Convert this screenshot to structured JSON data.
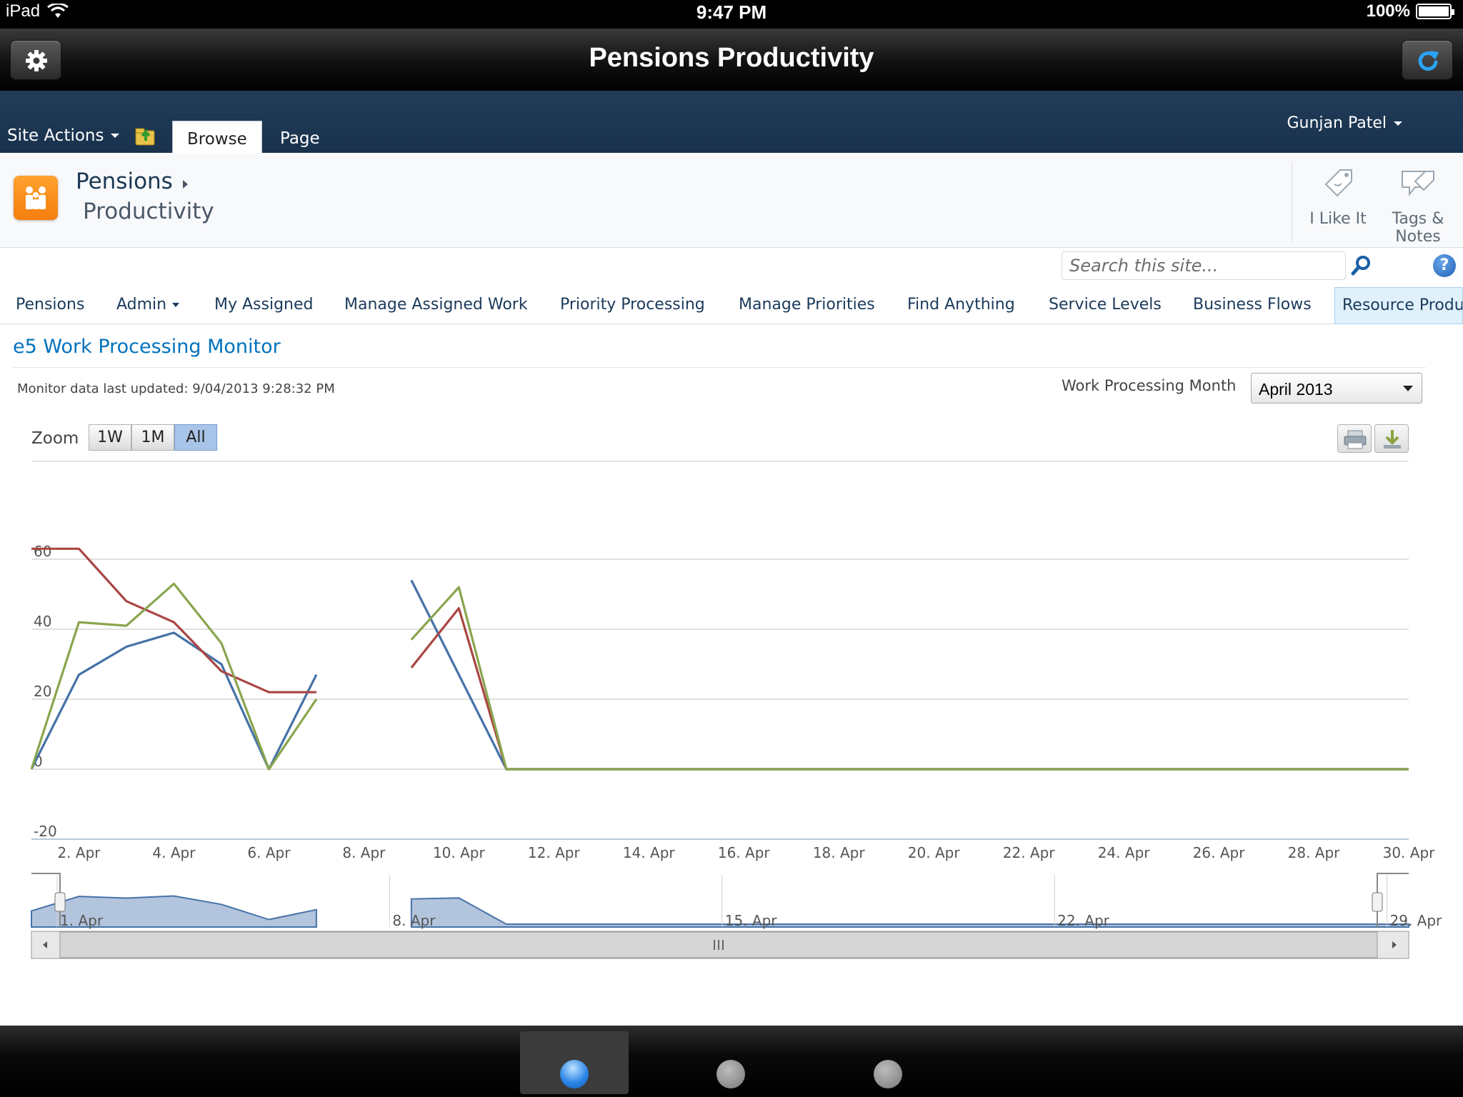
{
  "status_bar": {
    "device": "iPad",
    "time": "9:47 PM",
    "battery": "100%"
  },
  "app": {
    "title": "Pensions Productivity"
  },
  "ribbon": {
    "site_actions": "Site Actions",
    "tabs": [
      "Browse",
      "Page"
    ],
    "user": "Gunjan Patel"
  },
  "title_area": {
    "breadcrumb_root": "Pensions",
    "page_title": "Productivity",
    "like_label": "I Like It",
    "tags_label": "Tags & Notes"
  },
  "search": {
    "placeholder": "Search this site..."
  },
  "nav": {
    "items": [
      "Pensions",
      "Admin",
      "My Assigned",
      "Manage Assigned Work",
      "Priority Processing",
      "Manage Priorities",
      "Find Anything",
      "Service Levels",
      "Business Flows",
      "Resource Productivity"
    ]
  },
  "webpart": {
    "title": "e5 Work Processing Monitor",
    "last_updated": "Monitor data last updated: 9/04/2013 9:28:32 PM",
    "month_label": "Work Processing Month",
    "month_value": "April 2013"
  },
  "zoom": {
    "label": "Zoom",
    "options": [
      "1W",
      "1M",
      "All"
    ],
    "selected": "All"
  },
  "chart_data": {
    "type": "line",
    "x": [
      "1. Apr",
      "2. Apr",
      "3. Apr",
      "4. Apr",
      "5. Apr",
      "6. Apr",
      "7. Apr",
      "8. Apr",
      "9. Apr",
      "10. Apr",
      "11. Apr",
      "12. Apr",
      "13. Apr",
      "14. Apr",
      "15. Apr",
      "16. Apr",
      "17. Apr",
      "18. Apr",
      "19. Apr",
      "20. Apr",
      "21. Apr",
      "22. Apr",
      "23. Apr",
      "24. Apr",
      "25. Apr",
      "26. Apr",
      "27. Apr",
      "28. Apr",
      "29. Apr",
      "30. Apr"
    ],
    "x_tick_labels": [
      "2. Apr",
      "4. Apr",
      "6. Apr",
      "8. Apr",
      "10. Apr",
      "12. Apr",
      "14. Apr",
      "16. Apr",
      "18. Apr",
      "20. Apr",
      "22. Apr",
      "24. Apr",
      "26. Apr",
      "28. Apr",
      "30. Apr"
    ],
    "y_ticks": [
      -20,
      0,
      20,
      40,
      60
    ],
    "ylim": [
      -20,
      80
    ],
    "grid": true,
    "series": [
      {
        "color": "#4572a7",
        "values": [
          0,
          27,
          35,
          39,
          30,
          0,
          27,
          null,
          54,
          27,
          0,
          0,
          0,
          0,
          0,
          0,
          0,
          0,
          0,
          0,
          0,
          0,
          0,
          0,
          0,
          0,
          0,
          0,
          0,
          0
        ]
      },
      {
        "color": "#aa4643",
        "values": [
          63,
          63,
          48,
          42,
          28,
          22,
          22,
          null,
          29,
          46,
          0,
          0,
          0,
          0,
          0,
          0,
          0,
          0,
          0,
          0,
          0,
          0,
          0,
          0,
          0,
          0,
          0,
          0,
          0,
          0
        ]
      },
      {
        "color": "#89a54e",
        "values": [
          0,
          42,
          41,
          53,
          36,
          0,
          20,
          null,
          37,
          52,
          0,
          0,
          0,
          0,
          0,
          0,
          0,
          0,
          0,
          0,
          0,
          0,
          0,
          0,
          0,
          0,
          0,
          0,
          0,
          0
        ]
      }
    ],
    "navigator_labels": [
      "1. Apr",
      "8. Apr",
      "15. Apr",
      "22. Apr",
      "29. Apr"
    ]
  }
}
